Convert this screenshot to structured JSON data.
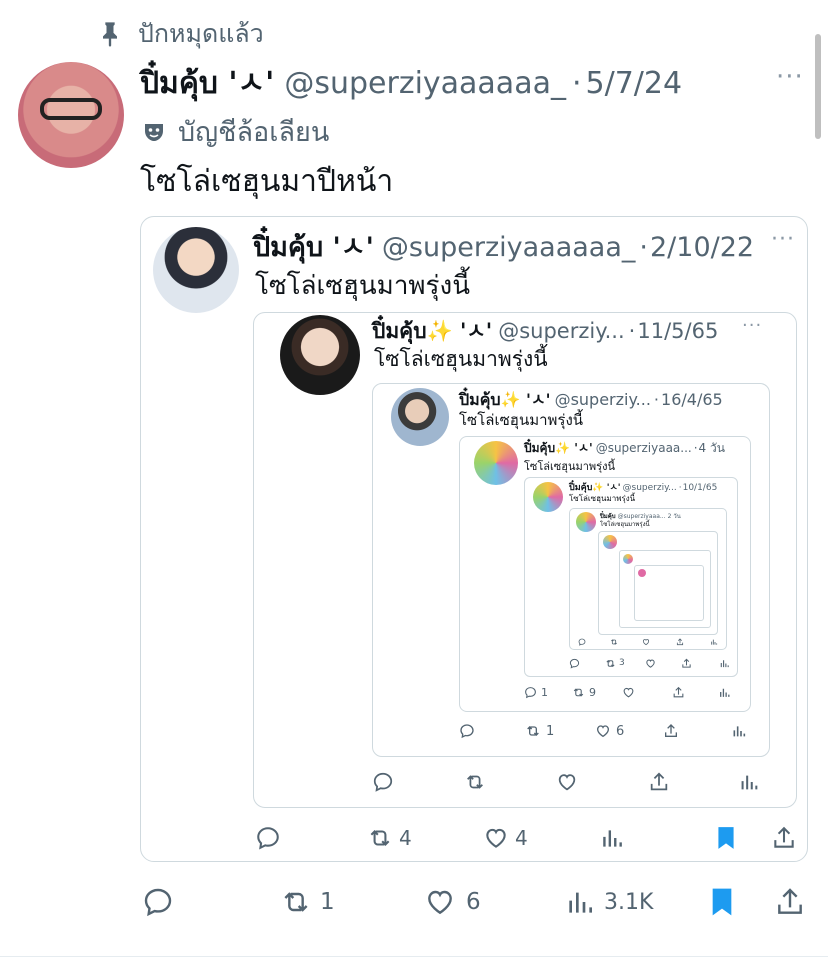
{
  "pinned": {
    "label": "ปักหมุดแล้ว",
    "icon": "pin-icon"
  },
  "tweet": {
    "name": "ปิ๋มคุ้บ 'ㅅ'",
    "handle": "@superziyaaaaaa_",
    "date": "5/7/24",
    "sep": "·",
    "more": "···",
    "parody_label": "บัญชีล้อเลียน",
    "parody_icon": "mask-icon",
    "text": "โซโล่เซฮุนมาปีหน้า",
    "actions": {
      "replies": "",
      "retweets": "1",
      "likes": "6",
      "views": "3.1K"
    },
    "accent": "#1d9bf0"
  },
  "quote1": {
    "name": "ปิ๋มคุ้บ 'ㅅ'",
    "handle": "@superziyaaaaaa_",
    "date": "2/10/22",
    "text": "โซโล่เซฮุนมาพรุ่งนี้",
    "actions": {
      "retweets": "4",
      "likes": "4"
    }
  },
  "quote2": {
    "name": "ปิ๋มคุ้บ✨ 'ㅅ'",
    "handle": "@superziy...",
    "date": "11/5/65",
    "text": "โซโล่เซฮุนมาพรุ่งนี้"
  },
  "quote3": {
    "name": "ปิ๋มคุ้บ✨ 'ㅅ'",
    "handle": "@superziy...",
    "date": "16/4/65",
    "text": "โซโล่เซฮุนมาพรุ่งนี้",
    "actions": {
      "retweets": "1",
      "likes": "6"
    }
  },
  "quote4": {
    "name": "ปิ๋มคุ้บ✨ 'ㅅ'",
    "handle": "@superziyaaa...",
    "date": "4 วัน",
    "text": "โซโล่เซฮุนมาพรุ่งนี้",
    "actions": {
      "replies": "1",
      "retweets": "9"
    }
  },
  "quote5": {
    "name": "ปิ๋มคุ้บ✨ 'ㅅ'",
    "handle": "@superziy...",
    "date": "10/1/65",
    "text": "โซโล่เซฮุนมาพรุ่งนี้",
    "actions": {
      "retweets": "3"
    }
  },
  "quote6": {
    "name": "ปิ๋มคุ้บ",
    "handle": "@superziyaaa...",
    "date": "2 วัน",
    "text": "โซโล่เซฮุนมาพรุ่งนี้"
  }
}
